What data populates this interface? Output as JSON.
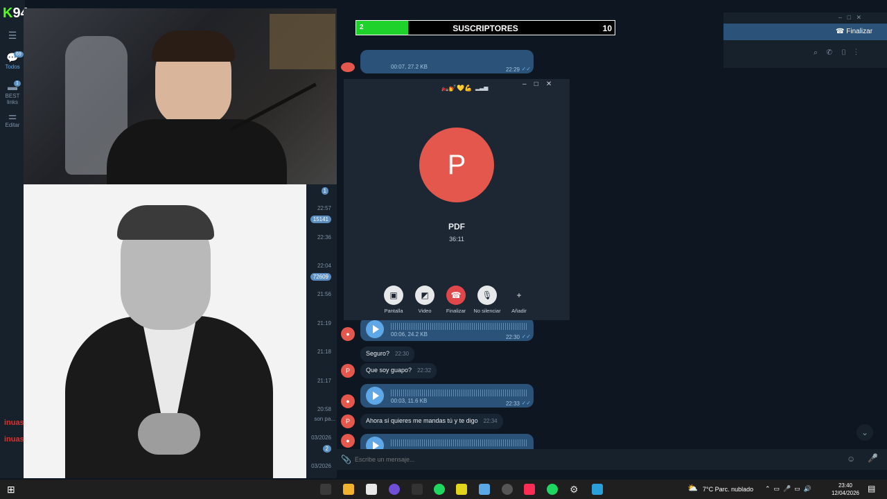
{
  "stream": {
    "logo_letter": "K",
    "logo_count": "94",
    "sub_goal": {
      "label": "SUSCRIPTORES",
      "current": "2",
      "target": "10",
      "progress": 0.2
    },
    "chat_overlay": [
      "inuas",
      "inuas"
    ]
  },
  "sidebar": {
    "items": [
      {
        "label": "Todos",
        "badge": "69"
      },
      {
        "label": "BEST links",
        "badge": "1"
      },
      {
        "label": "Editar",
        "badge": ""
      }
    ]
  },
  "chat_list": {
    "badge_top": "1",
    "rows": [
      {
        "time": "22:57",
        "badge": "15141"
      },
      {
        "time": "22:36",
        "badge": ""
      },
      {
        "time": "22:04",
        "badge": "72609"
      },
      {
        "time": "21:56",
        "badge": ""
      },
      {
        "time": "21:19",
        "badge": ""
      },
      {
        "time": "21:18",
        "badge": ""
      },
      {
        "time": "21:17",
        "badge": ""
      },
      {
        "time": "20:58",
        "badge": ""
      },
      {
        "time": "03/2026",
        "badge": "2"
      },
      {
        "time": "03/2026",
        "badge": ""
      }
    ],
    "snippet": "son pa..."
  },
  "header": {
    "end_call_label": "Finalizar",
    "icons": [
      "search-icon",
      "phone-icon",
      "sidebar-icon",
      "more-icon"
    ]
  },
  "call": {
    "emoji_row": "🏍️💅💛💪",
    "avatar_letter": "P",
    "name": "PDF",
    "duration": "36:11",
    "buttons": [
      {
        "label": "Pantalla",
        "icon": "screen-icon"
      },
      {
        "label": "Video",
        "icon": "video-off-icon"
      },
      {
        "label": "Finalizar",
        "icon": "hangup-icon"
      },
      {
        "label": "No silenciar",
        "icon": "mic-off-icon"
      },
      {
        "label": "Añadir",
        "icon": "add-user-icon"
      }
    ],
    "colors": {
      "hangup": "#e0474b",
      "avatar": "#e3574d"
    }
  },
  "messages": {
    "top_voice": {
      "meta": "00:07, 27.2 KB",
      "time": "22:29"
    },
    "voice1": {
      "meta": "00:06, 24.2 KB",
      "time": "22:30"
    },
    "text1": {
      "text": "Seguro?",
      "time": "22:30"
    },
    "text2": {
      "text": "Que soy guapo?",
      "time": "22:32"
    },
    "voice2": {
      "meta": "00:03, 11.6 KB",
      "time": "22:33"
    },
    "text3": {
      "text": "Ahora sí quieres me mandas tú y te digo",
      "time": "22:34"
    }
  },
  "input": {
    "placeholder": "Escribe un mensaje..."
  },
  "taskbar": {
    "weather": "7°C  Parc. nublado",
    "time": "23:40",
    "date": "12/04/2026"
  }
}
